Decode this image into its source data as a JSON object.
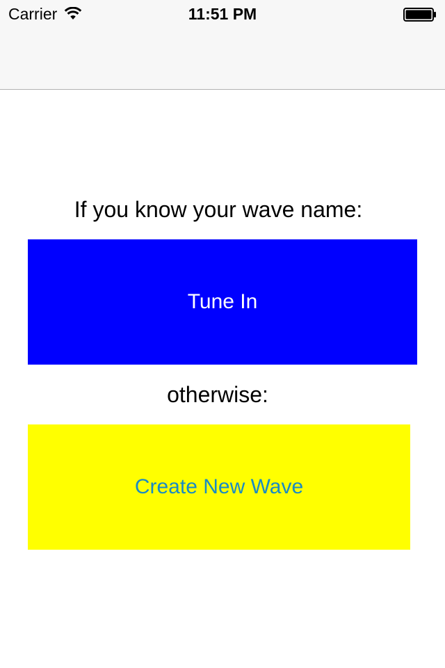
{
  "status_bar": {
    "carrier": "Carrier",
    "wifi_icon": "wifi-icon",
    "time": "11:51 PM",
    "battery_icon": "battery-icon"
  },
  "content": {
    "prompt_known": "If you know your wave name:",
    "tune_in_label": "Tune In",
    "prompt_otherwise": "otherwise:",
    "create_label": "Create New Wave"
  },
  "colors": {
    "tune_in_bg": "#0000FF",
    "tune_in_text": "#FFFFFF",
    "create_bg": "#FFFF00",
    "create_text": "#1A8BC3"
  }
}
